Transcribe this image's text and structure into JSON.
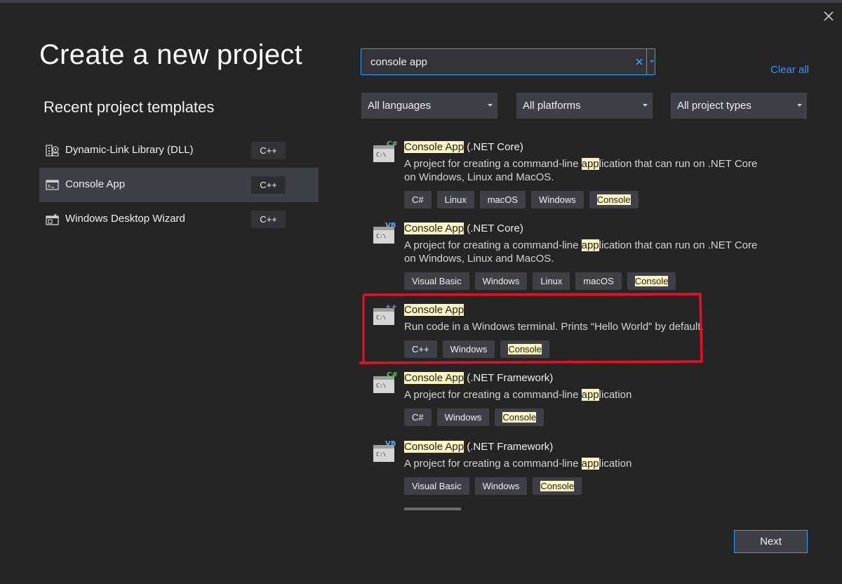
{
  "header": {
    "title": "Create a new project",
    "close_icon": "close-icon"
  },
  "recent": {
    "title": "Recent project templates",
    "items": [
      {
        "label": "Dynamic-Link Library (DLL)",
        "lang": "C++",
        "icon": "dll-icon"
      },
      {
        "label": "Console App",
        "lang": "C++",
        "icon": "console-app-icon",
        "selected": true
      },
      {
        "label": "Windows Desktop Wizard",
        "lang": "C++",
        "icon": "windows-desktop-icon"
      }
    ]
  },
  "search": {
    "value": "console app",
    "clear_icon": "clear-icon",
    "dropdown_icon": "dropdown-icon"
  },
  "clear_all": "Clear all",
  "filters": {
    "languages": "All languages",
    "platforms": "All platforms",
    "types": "All project types"
  },
  "results": [
    {
      "badge": "C#",
      "name_highlight": "Console App",
      "name_rest": " (.NET Core)",
      "desc_parts": [
        "A project for creating a command-line ",
        "app",
        "lication that can run on .NET Core on Windows, Linux and MacOS."
      ],
      "tags": [
        "C#",
        "Linux",
        "macOS",
        "Windows",
        "Console"
      ]
    },
    {
      "badge": "VB",
      "name_highlight": "Console App",
      "name_rest": " (.NET Core)",
      "desc_parts": [
        "A project for creating a command-line ",
        "app",
        "lication that can run on .NET Core on Windows, Linux and MacOS."
      ],
      "tags": [
        "Visual Basic",
        "Windows",
        "Linux",
        "macOS",
        "Console"
      ]
    },
    {
      "badge": "++",
      "name_highlight": "Console App",
      "name_rest": "",
      "desc_parts": [
        "Run code in a Windows terminal. Prints “Hello World” by default.",
        "",
        ""
      ],
      "tags": [
        "C++",
        "Windows",
        "Console"
      ]
    },
    {
      "badge": "C#",
      "name_highlight": "Console App",
      "name_rest": " (.NET Framework)",
      "desc_parts": [
        "A project for creating a command-line ",
        "app",
        "lication"
      ],
      "tags": [
        "C#",
        "Windows",
        "Console"
      ]
    },
    {
      "badge": "VB",
      "name_highlight": "Console App",
      "name_rest": " (.NET Framework)",
      "desc_parts": [
        "A project for creating a command-line ",
        "app",
        "lication"
      ],
      "tags": [
        "Visual Basic",
        "Windows",
        "Console"
      ]
    }
  ],
  "highlighted_tag": "Console",
  "annotation_color": "#e81123",
  "accent_color": "#3399ff",
  "next_label": "Next"
}
